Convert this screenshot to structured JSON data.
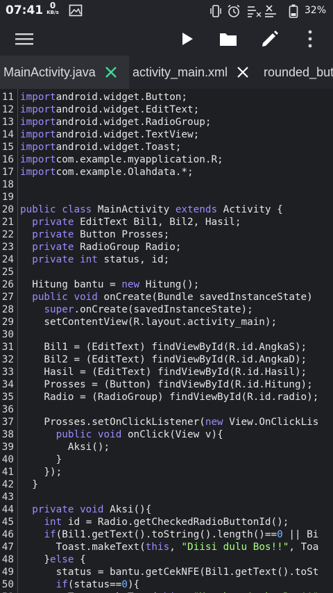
{
  "status_bar": {
    "time": "07:41",
    "net_speed_value": "0",
    "net_speed_unit": "KB/s",
    "battery_percent": "32%"
  },
  "toolbar": {
    "menu_icon": "hamburger-menu-icon",
    "run_icon": "play-icon",
    "open_icon": "folder-icon",
    "edit_icon": "pencil-icon",
    "more_icon": "more-vert-icon"
  },
  "tabs": [
    {
      "label": "MainActivity.java",
      "active": true
    },
    {
      "label": "activity_main.xml",
      "active": false
    },
    {
      "label": "rounded_butt",
      "active": false
    }
  ],
  "colors": {
    "keyword": "#9b8cff",
    "string": "#a6ff7a",
    "number": "#7ab6ff",
    "accent_close": "#3ddc97",
    "background": "#1e1f23"
  },
  "code": [
    {
      "n": "11",
      "t": [
        [
          "kw",
          "import"
        ],
        [
          "",
          "android.widget.Button;"
        ]
      ]
    },
    {
      "n": "12",
      "t": [
        [
          "kw",
          "import"
        ],
        [
          "",
          "android.widget.EditText;"
        ]
      ]
    },
    {
      "n": "13",
      "t": [
        [
          "kw",
          "import"
        ],
        [
          "",
          "android.widget.RadioGroup;"
        ]
      ]
    },
    {
      "n": "14",
      "t": [
        [
          "kw",
          "import"
        ],
        [
          "",
          "android.widget.TextView;"
        ]
      ]
    },
    {
      "n": "15",
      "t": [
        [
          "kw",
          "import"
        ],
        [
          "",
          "android.widget.Toast;"
        ]
      ]
    },
    {
      "n": "16",
      "t": [
        [
          "kw",
          "import"
        ],
        [
          "",
          "com.example.myapplication.R;"
        ]
      ]
    },
    {
      "n": "17",
      "t": [
        [
          "kw",
          "import"
        ],
        [
          "",
          "com.example.Olahdata.*;"
        ]
      ]
    },
    {
      "n": "18",
      "t": []
    },
    {
      "n": "19",
      "t": []
    },
    {
      "n": "20",
      "t": [
        [
          "kw",
          "public class"
        ],
        [
          "",
          " MainActivity "
        ],
        [
          "kw",
          "extends"
        ],
        [
          "",
          " Activity {"
        ]
      ]
    },
    {
      "n": "21",
      "t": [
        [
          "",
          "  "
        ],
        [
          "kw",
          "private"
        ],
        [
          "",
          " EditText Bil1, Bil2, Hasil;"
        ]
      ]
    },
    {
      "n": "22",
      "t": [
        [
          "",
          "  "
        ],
        [
          "kw",
          "private"
        ],
        [
          "",
          " Button Prosses;"
        ]
      ]
    },
    {
      "n": "23",
      "t": [
        [
          "",
          "  "
        ],
        [
          "kw",
          "private"
        ],
        [
          "",
          " RadioGroup Radio;"
        ]
      ]
    },
    {
      "n": "24",
      "t": [
        [
          "",
          "  "
        ],
        [
          "kw",
          "private int"
        ],
        [
          "",
          " status, id;"
        ]
      ]
    },
    {
      "n": "25",
      "t": []
    },
    {
      "n": "26",
      "t": [
        [
          "",
          "  Hitung bantu = "
        ],
        [
          "kw",
          "new"
        ],
        [
          "",
          " Hitung();"
        ]
      ]
    },
    {
      "n": "27",
      "t": [
        [
          "",
          "  "
        ],
        [
          "kw",
          "public void"
        ],
        [
          "",
          " onCreate(Bundle savedInstanceState)"
        ]
      ]
    },
    {
      "n": "28",
      "t": [
        [
          "",
          "    "
        ],
        [
          "kw",
          "super"
        ],
        [
          "",
          ".onCreate(savedInstanceState);"
        ]
      ]
    },
    {
      "n": "29",
      "t": [
        [
          "",
          "    setContentView(R.layout.activity_main);"
        ]
      ]
    },
    {
      "n": "30",
      "t": []
    },
    {
      "n": "31",
      "t": [
        [
          "",
          "    Bil1 = (EditText) findViewById(R.id.AngkaS);"
        ]
      ]
    },
    {
      "n": "32",
      "t": [
        [
          "",
          "    Bil2 = (EditText) findViewById(R.id.AngkaD);"
        ]
      ]
    },
    {
      "n": "33",
      "t": [
        [
          "",
          "    Hasil = (EditText) findViewById(R.id.Hasil);"
        ]
      ]
    },
    {
      "n": "34",
      "t": [
        [
          "",
          "    Prosses = (Button) findViewById(R.id.Hitung);"
        ]
      ]
    },
    {
      "n": "35",
      "t": [
        [
          "",
          "    Radio = (RadioGroup) findViewById(R.id.radio);"
        ]
      ]
    },
    {
      "n": "36",
      "t": []
    },
    {
      "n": "37",
      "t": [
        [
          "",
          "    Prosses.setOnClickListener("
        ],
        [
          "kw",
          "new"
        ],
        [
          "",
          " View.OnClickLis"
        ]
      ]
    },
    {
      "n": "38",
      "t": [
        [
          "",
          "      "
        ],
        [
          "kw",
          "public void"
        ],
        [
          "",
          " onClick(View v){"
        ]
      ]
    },
    {
      "n": "39",
      "t": [
        [
          "",
          "        Aksi();"
        ]
      ]
    },
    {
      "n": "40",
      "t": [
        [
          "",
          "      }"
        ]
      ]
    },
    {
      "n": "41",
      "t": [
        [
          "",
          "    });"
        ]
      ]
    },
    {
      "n": "42",
      "t": [
        [
          "",
          "  }"
        ]
      ]
    },
    {
      "n": "43",
      "t": []
    },
    {
      "n": "44",
      "t": [
        [
          "",
          "  "
        ],
        [
          "kw",
          "private void"
        ],
        [
          "",
          " Aksi(){"
        ]
      ]
    },
    {
      "n": "45",
      "t": [
        [
          "",
          "    "
        ],
        [
          "kw",
          "int"
        ],
        [
          "",
          " id = Radio.getCheckedRadioButtonId();"
        ]
      ]
    },
    {
      "n": "46",
      "t": [
        [
          "",
          "    "
        ],
        [
          "kw",
          "if"
        ],
        [
          "",
          "(Bil1.getText().toString().length()=="
        ],
        [
          "num",
          "0"
        ],
        [
          "",
          " || Bi"
        ]
      ]
    },
    {
      "n": "47",
      "t": [
        [
          "",
          "      Toast.makeText("
        ],
        [
          "kw",
          "this"
        ],
        [
          "",
          ", "
        ],
        [
          "str",
          "\"Diisi dulu Bos!!\""
        ],
        [
          "",
          ", Toa"
        ]
      ]
    },
    {
      "n": "48",
      "t": [
        [
          "",
          "    }"
        ],
        [
          "kw",
          "else"
        ],
        [
          "",
          " {"
        ]
      ]
    },
    {
      "n": "49",
      "t": [
        [
          "",
          "      status = bantu.getCekNFE(Bil1.getText().toSt"
        ]
      ]
    },
    {
      "n": "50",
      "t": [
        [
          "",
          "      "
        ],
        [
          "kw",
          "if"
        ],
        [
          "",
          "(status=="
        ],
        [
          "num",
          "0"
        ],
        [
          "",
          "){"
        ]
      ]
    },
    {
      "n": "51",
      "t": [
        [
          "",
          "        Toast.makeText("
        ],
        [
          "kw",
          "this"
        ],
        [
          "",
          ", "
        ],
        [
          "str",
          "\"Masukan Angka Bos!!\""
        ]
      ]
    }
  ]
}
